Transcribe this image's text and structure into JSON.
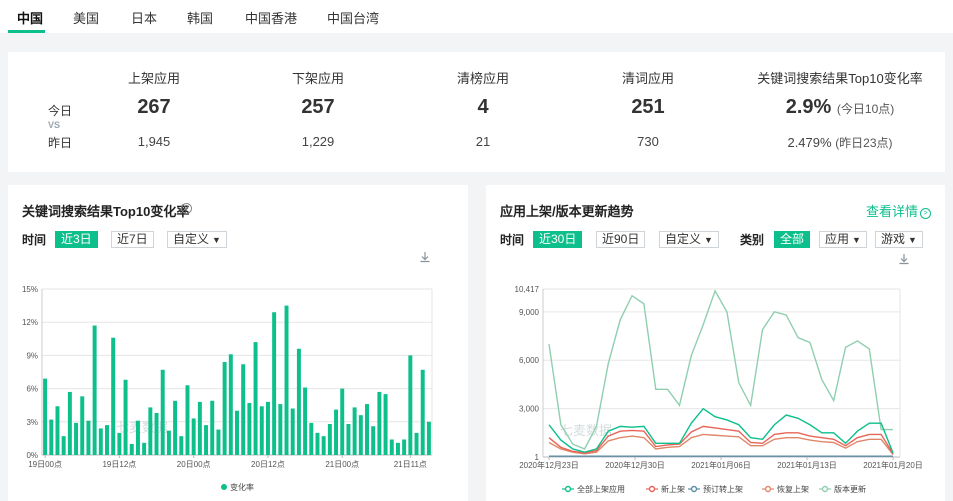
{
  "tabs": [
    {
      "label": "中国",
      "active": true
    },
    {
      "label": "美国"
    },
    {
      "label": "日本"
    },
    {
      "label": "韩国"
    },
    {
      "label": "中国香港"
    },
    {
      "label": "中国台湾"
    }
  ],
  "summary": {
    "today_label": "今日",
    "vs_label": "VS",
    "yesterday_label": "昨日",
    "columns": [
      {
        "header": "上架应用",
        "today": "267",
        "yesterday": "1,945"
      },
      {
        "header": "下架应用",
        "today": "257",
        "yesterday": "1,229"
      },
      {
        "header": "清榜应用",
        "today": "4",
        "yesterday": "21"
      },
      {
        "header": "清词应用",
        "today": "251",
        "yesterday": "730"
      },
      {
        "header": "关键词搜索结果Top10变化率",
        "today": "2.9%",
        "today_suffix": "(今日10点)",
        "yesterday": "2.479%",
        "yesterday_suffix": "(昨日23点)"
      }
    ]
  },
  "left_panel": {
    "title": "关键词搜索结果Top10变化率",
    "help_icon": "question-circle-icon",
    "time_label": "时间",
    "time_options": [
      "近3日",
      "近7日"
    ],
    "active_time": "近3日",
    "custom_label": "自定义",
    "download_icon": "download-icon"
  },
  "right_panel": {
    "title": "应用上架/版本更新趋势",
    "detail_link": "查看详情",
    "time_label": "时间",
    "time_options": [
      "近30日",
      "近90日"
    ],
    "active_time": "近30日",
    "custom_label": "自定义",
    "category_label": "类别",
    "category_all": "全部",
    "category_app": "应用",
    "category_game": "游戏",
    "download_icon": "download-icon"
  },
  "watermark": "七麦数据",
  "colors": {
    "accent": "#0cbf8b",
    "new": "#e8645a",
    "preorder": "#5b8ca6",
    "restore": "#e0876a",
    "update": "#8fcfb0"
  },
  "chart_data": [
    {
      "type": "bar",
      "title": "关键词搜索结果Top10变化率",
      "ylabel": "",
      "ylim": [
        0,
        15
      ],
      "yticks": [
        "0%",
        "3%",
        "6%",
        "9%",
        "12%",
        "15%"
      ],
      "xticks": [
        {
          "index": 0,
          "label": "19日00点"
        },
        {
          "index": 12,
          "label": "19日12点"
        },
        {
          "index": 24,
          "label": "20日00点"
        },
        {
          "index": 36,
          "label": "20日12点"
        },
        {
          "index": 48,
          "label": "21日00点"
        },
        {
          "index": 59,
          "label": "21日11点"
        }
      ],
      "legend": "变化率",
      "values": [
        6.9,
        3.2,
        4.4,
        1.7,
        5.7,
        2.9,
        5.3,
        3.1,
        11.7,
        2.4,
        2.7,
        10.6,
        2.0,
        6.8,
        1.0,
        3.1,
        1.1,
        4.3,
        3.8,
        7.7,
        2.2,
        4.9,
        1.7,
        6.3,
        3.3,
        4.8,
        2.7,
        4.9,
        2.3,
        8.4,
        9.1,
        4.0,
        8.2,
        4.7,
        10.2,
        4.4,
        4.8,
        12.9,
        4.6,
        13.5,
        4.2,
        9.6,
        6.1,
        2.9,
        2.0,
        1.7,
        2.8,
        4.1,
        6.0,
        2.8,
        4.3,
        3.6,
        4.6,
        2.6,
        5.7,
        5.5,
        1.4,
        1.1,
        1.4,
        9.0,
        2.0,
        7.7,
        3.0
      ]
    },
    {
      "type": "line",
      "title": "应用上架/版本更新趋势",
      "ylim": [
        1,
        10417
      ],
      "yticks": [
        "1",
        "3,000",
        "6,000",
        "9,000",
        "10,417"
      ],
      "x_labels": [
        "2020年12月23日",
        "2020年12月30日",
        "2021年01月06日",
        "2021年01月13日",
        "2021年01月20日"
      ],
      "series": [
        {
          "name": "全部上架应用",
          "color": "#0cbf8b",
          "values": [
            2000,
            1050,
            500,
            300,
            500,
            1600,
            1900,
            1850,
            1900,
            850,
            850,
            850,
            2100,
            3000,
            2500,
            2300,
            2000,
            1200,
            1100,
            2000,
            2600,
            2400,
            2000,
            1500,
            1500,
            850,
            1600,
            2100,
            2100,
            250
          ]
        },
        {
          "name": "新上架",
          "color": "#e8645a",
          "values": [
            1200,
            600,
            350,
            250,
            400,
            1300,
            1600,
            1650,
            1600,
            650,
            750,
            800,
            1550,
            1900,
            1800,
            1700,
            1600,
            900,
            850,
            1400,
            1500,
            1500,
            1300,
            1200,
            1100,
            700,
            1200,
            1400,
            1400,
            200
          ]
        },
        {
          "name": "预订转上架",
          "color": "#5b8ca6",
          "values": [
            50,
            50,
            50,
            50,
            50,
            50,
            50,
            50,
            50,
            50,
            50,
            50,
            50,
            50,
            50,
            50,
            50,
            50,
            50,
            50,
            50,
            50,
            50,
            50,
            50,
            50,
            50,
            50,
            50,
            50
          ]
        },
        {
          "name": "恢复上架",
          "color": "#e0876a",
          "values": [
            900,
            500,
            300,
            200,
            300,
            1000,
            1200,
            1300,
            1200,
            500,
            600,
            650,
            1200,
            1400,
            1350,
            1300,
            1250,
            700,
            700,
            1100,
            1200,
            1200,
            1050,
            950,
            900,
            550,
            950,
            1100,
            1100,
            150
          ]
        },
        {
          "name": "版本更新",
          "color": "#8fcfb0",
          "values": [
            7000,
            2000,
            800,
            500,
            1900,
            5800,
            8500,
            10000,
            9500,
            4200,
            4200,
            3200,
            6300,
            8200,
            10300,
            9000,
            4600,
            3200,
            7900,
            9000,
            8800,
            7400,
            7100,
            4800,
            3500,
            6800,
            7200,
            6700,
            1700,
            1700
          ]
        }
      ]
    }
  ]
}
